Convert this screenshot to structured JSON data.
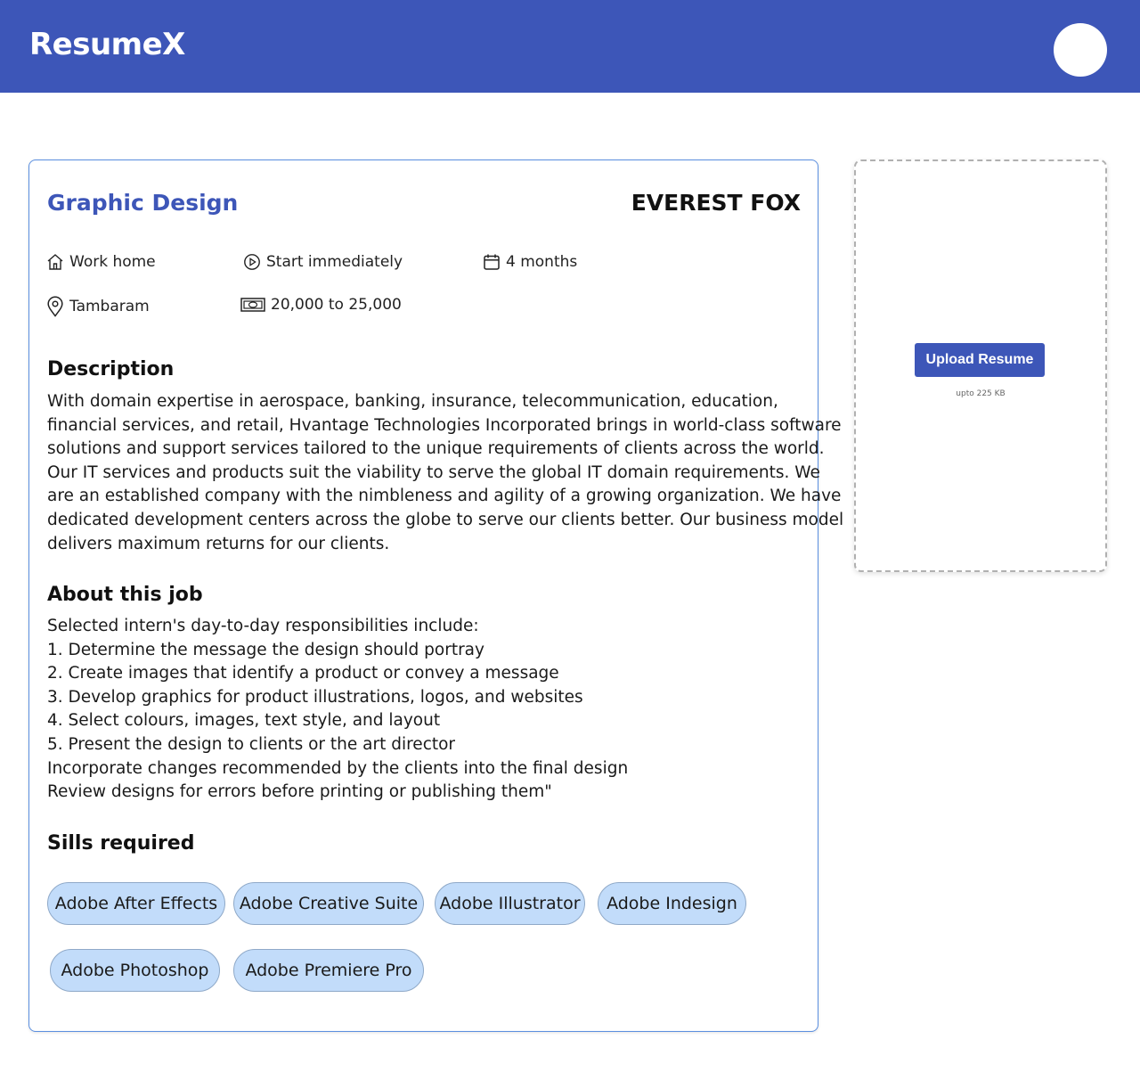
{
  "app": {
    "title": "ResumeX"
  },
  "job": {
    "title": "Graphic Design",
    "company": "EVEREST FOX",
    "meta": {
      "work_type": "Work home",
      "start": "Start immediately",
      "duration": "4 months",
      "location": "Tambaram",
      "stipend": "20,000 to 25,000"
    },
    "description_heading": "Description",
    "description_lines": [
      "With domain expertise in aerospace, banking, insurance, telecommunication, education,",
      "financial services, and retail, Hvantage Technologies Incorporated brings in world-class software",
      "solutions and support services tailored to the unique requirements of clients across the world.",
      "Our IT services and products suit the viability to serve the global IT domain requirements. We",
      "are an established company with the nimbleness and agility of a growing organization. We have",
      "dedicated development centers across the globe to serve our clients better. Our business model",
      "delivers maximum returns for our clients."
    ],
    "about_heading": "About this job",
    "about_lines": [
      "Selected intern's day-to-day responsibilities include:",
      "1. Determine the message the design should portray",
      "2. Create images that identify a product or convey a message",
      "3. Develop graphics for product illustrations, logos, and websites",
      "4. Select colours, images, text style, and layout",
      "5. Present the design to clients or the art director",
      "Incorporate changes recommended by the clients into the final design",
      "Review designs for errors before printing or publishing them\""
    ],
    "skills_heading": "Sills required",
    "skills": [
      "Adobe After Effects",
      "Adobe Creative Suite",
      "Adobe Illustrator",
      "Adobe Indesign",
      "Adobe Photoshop",
      "Adobe Premiere Pro"
    ]
  },
  "upload": {
    "button_label": "Upload Resume",
    "note": "upto 225 KB"
  },
  "colors": {
    "brand": "#3d56b8",
    "chip_bg": "#c2dcfa",
    "card_border": "#5b8fe0"
  }
}
